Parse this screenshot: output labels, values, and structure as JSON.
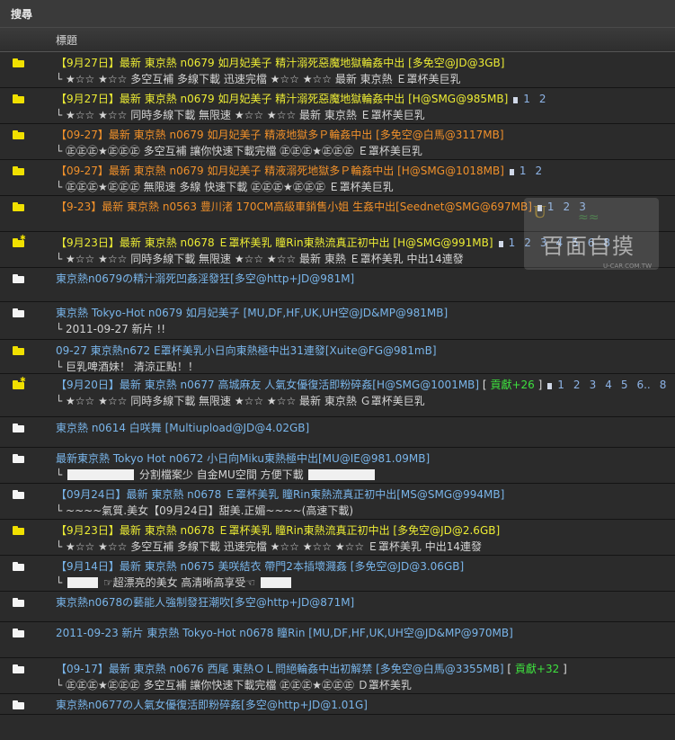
{
  "topbar": {
    "title": "搜尋"
  },
  "header": {
    "title_col": "標題"
  },
  "watermark": {
    "main": "百面自摸",
    "sub": "U-CAR.COM.TW"
  },
  "rows": [
    {
      "icon": "yellow",
      "hot": false,
      "title": "【9月27日】最新 東京熱 n0679 如月妃美子 精汁溺死惡魔地獄輪姦中出 [多免空@JD@3GB]",
      "color": "t-yellow",
      "line2": "└ ★☆☆ ★☆☆ 多空互補 多線下載 迅速完檔 ★☆☆ ★☆☆ 最新 東京熱 Ｅ罩杯美巨乳",
      "pages": []
    },
    {
      "icon": "yellow",
      "hot": false,
      "title": "【9月27日】最新 東京熱 n0679 如月妃美子 精汁溺死惡魔地獄輪姦中出 [H@SMG@985MB]",
      "color": "t-yellow",
      "line2": "└ ★☆☆ ★☆☆ 同時多線下載 無限速 ★☆☆ ★☆☆ 最新 東京熱 Ｅ罩杯美巨乳",
      "pages": [
        "1",
        "2"
      ]
    },
    {
      "icon": "yellow",
      "hot": false,
      "title": "【09-27】最新 東京熱 n0679 如月妃美子 精液地獄多Ｐ輪姦中出 [多免空@白馬@3117MB]",
      "color": "t-orange",
      "line2": "└ ㊣㊣㊣★㊣㊣㊣ 多空互補 讓你快速下載完檔 ㊣㊣㊣★㊣㊣㊣ Ｅ罩杯美巨乳",
      "pages": []
    },
    {
      "icon": "yellow",
      "hot": false,
      "title": "【09-27】最新 東京熱 n0679 如月妃美子 精液溺死地獄多Ｐ輪姦中出 [H@SMG@1018MB]",
      "color": "t-orange",
      "line2": "└ ㊣㊣㊣★㊣㊣㊣ 無限速 多線 快速下載 ㊣㊣㊣★㊣㊣㊣ Ｅ罩杯美巨乳",
      "pages": [
        "1",
        "2"
      ]
    },
    {
      "icon": "yellow",
      "hot": false,
      "title": "【9-23】最新 東京熱 n0563 豊川渚 170CM高級車銷售小姐 生姦中出[Seednet@SMG@697MB]",
      "color": "t-orange",
      "line2": "",
      "pages": [
        "1",
        "2",
        "3"
      ]
    },
    {
      "icon": "yellow",
      "hot": true,
      "title": "【9月23日】最新 東京熱 n0678 Ｅ罩杯美乳 瞳Rin東熱流真正初中出 [H@SMG@991MB]",
      "color": "t-yellow",
      "line2": "└ ★☆☆ ★☆☆ 同時多線下載 無限速 ★☆☆ ★☆☆ 最新 東熱 Ｅ罩杯美乳 中出14連發",
      "pages": [
        "1",
        "2",
        "3",
        "4",
        "5",
        "6",
        "8"
      ]
    },
    {
      "icon": "white",
      "hot": false,
      "title": "東京熱n0679の精汁溺死凹姦淫發狂[多空@http+JD@981M]",
      "color": "t-blue",
      "line2": "",
      "pages": []
    },
    {
      "icon": "white",
      "hot": false,
      "title": "東京熱 Tokyo-Hot n0679 如月妃美子 [MU,DF,HF,UK,UH空@JD&MP@981MB]",
      "color": "t-blue",
      "line2": "└ 2011-09-27 新片 !!",
      "pages": []
    },
    {
      "icon": "yellow",
      "hot": false,
      "title": "09-27 東京熱n672 E罩杯美乳小日向東熱極中出31連發[Xuite@FG@981mB]",
      "color": "t-blue",
      "line2": "└ 巨乳啤酒妹！ 清涼正點！！",
      "pages": []
    },
    {
      "icon": "yellow",
      "hot": true,
      "title": "【9月20日】最新 東京熱 n0677 高城麻友 人氣女優復活即粉碎姦[H@SMG@1001MB]",
      "color": "t-blue",
      "line2": "└ ★☆☆ ★☆☆ 同時多線下載 無限速 ★☆☆ ★☆☆ 最新 東京熱 Ｇ罩杯美巨乳",
      "contrib": "貢獻+26",
      "pages": [
        "1",
        "2",
        "3",
        "4",
        "5",
        "6..",
        "8"
      ]
    },
    {
      "icon": "white",
      "hot": false,
      "title": "東京熱 n0614 白咲舞 [Multiupload@JD@4.02GB]",
      "color": "t-blue",
      "line2": "",
      "pages": []
    },
    {
      "icon": "white",
      "hot": false,
      "title": "最新東京熱 Tokyo Hot n0672 小日向Miku東熱極中出[MU@IE@981.09MB]",
      "color": "t-blue",
      "line2": "└ [box] 分割檔案少 自金MU空間 方便下載 [box]",
      "pages": []
    },
    {
      "icon": "white",
      "hot": false,
      "title": "【09月24日】最新 東京熱 n0678 Ｅ罩杯美乳 瞳Rin東熱流真正初中出[MS@SMG@994MB]",
      "color": "t-blue",
      "line2": "└ ~~~~氣質.美女【09月24日】甜美.正媚~~~~(高速下載)",
      "pages": []
    },
    {
      "icon": "yellow",
      "hot": false,
      "title": "【9月23日】最新 東京熱 n0678 Ｅ罩杯美乳 瞳Rin東熱流真正初中出 [多免空@JD@2.6GB]",
      "color": "t-yellow",
      "line2": "└ ★☆☆ ★☆☆ 多空互補 多線下載 迅速完檔 ★☆☆ ★☆☆ ★☆☆ Ｅ罩杯美乳 中出14連發",
      "pages": []
    },
    {
      "icon": "white",
      "hot": false,
      "title": "【9月14日】最新 東京熱 n0675 美咲結衣 帶門2本插壞濺姦 [多免空@JD@3.06GB]",
      "color": "t-blue",
      "line2": "└ [sbox] ☞超漂亮的美女 高清晰高享受☜ [sbox]",
      "pages": []
    },
    {
      "icon": "white",
      "hot": false,
      "title": "東京熱n0678の藝能人強制發狂潮吹[多空@http+JD@871M]",
      "color": "t-blue",
      "line2": "",
      "pages": []
    },
    {
      "icon": "white",
      "hot": false,
      "title": "2011-09-23 新片 東京熱 Tokyo-Hot n0678 瞳Rin [MU,DF,HF,UK,UH空@JD&MP@970MB]",
      "color": "t-blue",
      "line2": "",
      "pages": []
    },
    {
      "icon": "white",
      "hot": false,
      "title": "【09-17】最新 東京熱 n0676 西尾 東熱ＯＬ問絕輪姦中出初解禁 [多免空@白馬@3355MB]",
      "color": "t-blue",
      "line2": "└ ㊣㊣㊣★㊣㊣㊣ 多空互補 讓你快速下載完檔 ㊣㊣㊣★㊣㊣㊣ Ｄ罩杯美乳",
      "contrib": "貢獻+32",
      "pages": []
    },
    {
      "icon": "white",
      "hot": false,
      "title": "東京熱n0677の人氣女優復活即粉碎姦[多空@http+JD@1.01G]",
      "color": "t-blue",
      "line2": "",
      "pages": []
    }
  ]
}
